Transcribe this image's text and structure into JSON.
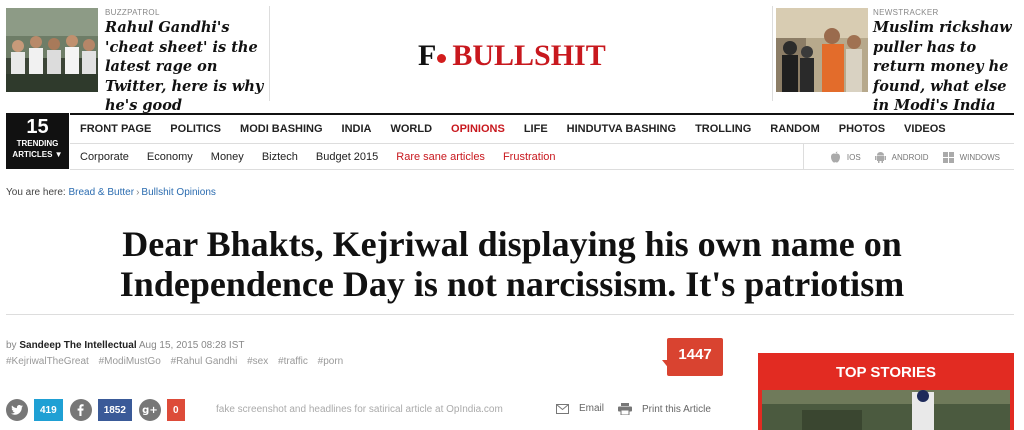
{
  "header": {
    "left_promo": {
      "kicker": "BUZZPATROL",
      "title": "Rahul Gandhi's 'cheat sheet' is the latest rage on Twitter, here is why he's good"
    },
    "logo": {
      "letter": "F",
      "word": "BULLSHIT"
    },
    "right_promo": {
      "kicker": "NEWSTRACKER",
      "title": "Muslim rickshaw puller has to return money he found, what else in Modi's India"
    }
  },
  "nav": {
    "trending": {
      "count": "15",
      "line1": "TRENDING",
      "line2": "ARTICLES"
    },
    "primary": [
      "FRONT PAGE",
      "POLITICS",
      "MODI BASHING",
      "INDIA",
      "WORLD",
      "OPINIONS",
      "LIFE",
      "HINDUTVA BASHING",
      "TROLLING",
      "RANDOM",
      "PHOTOS",
      "VIDEOS"
    ],
    "active_primary": "OPINIONS",
    "secondary": [
      "Corporate",
      "Economy",
      "Money",
      "Biztech",
      "Budget 2015",
      "Rare sane articles",
      "Frustration"
    ],
    "apps": [
      "IOS",
      "ANDROID",
      "WINDOWS"
    ]
  },
  "breadcrumb": {
    "prefix": "You are here:",
    "items": [
      "Bread & Butter",
      "Bullshit Opinions"
    ]
  },
  "article": {
    "headline": "Dear Bhakts, Kejriwal displaying his own name on Independence Day is not narcissism. It's patriotism",
    "byline_prefix": "by",
    "author": "Sandeep The Intellectual",
    "date": "Aug 15, 2015 08:28 IST",
    "tags": [
      "#KejriwalTheGreat",
      "#ModiMustGo",
      "#Rahul Gandhi",
      "#sex",
      "#traffic",
      "#porn"
    ],
    "comment_count": "1447"
  },
  "share": {
    "twitter_count": "419",
    "facebook_count": "1852",
    "gplus_count": "0",
    "disclaimer": "fake screenshot and headlines for satirical article at OpIndia.com",
    "email_label": "Email",
    "print_label": "Print this Article"
  },
  "sidebar": {
    "top_stories_title": "TOP STORIES"
  },
  "colors": {
    "brand_red": "#c8181e",
    "twitter": "#1fa0d4",
    "facebook": "#3a5a98",
    "gplus": "#dd4b39",
    "top_stories_bg": "#e22b22"
  }
}
